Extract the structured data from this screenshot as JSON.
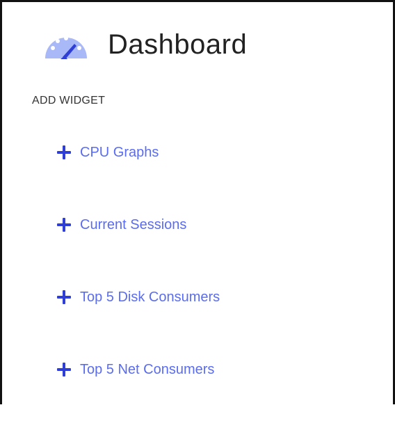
{
  "header": {
    "title": "Dashboard",
    "icon": "dashboard-gauge-icon",
    "icon_colors": {
      "dial": "#a9b8f7",
      "needle": "#2f3fd6",
      "dots": "#ffffff"
    }
  },
  "add_widget": {
    "section_label": "ADD WIDGET",
    "accent_color": "#5a6cf0",
    "items": [
      {
        "label": "CPU Graphs",
        "icon": "plus-icon"
      },
      {
        "label": "Current Sessions",
        "icon": "plus-icon"
      },
      {
        "label": "Top 5 Disk Consumers",
        "icon": "plus-icon"
      },
      {
        "label": "Top 5 Net Consumers",
        "icon": "plus-icon"
      }
    ]
  }
}
